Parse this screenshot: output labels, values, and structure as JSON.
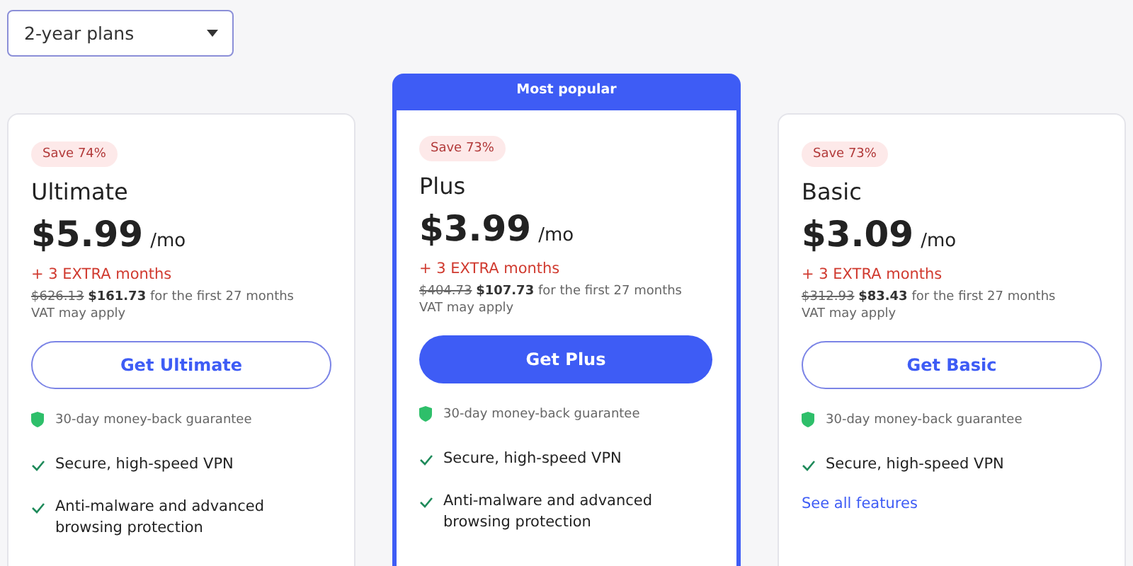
{
  "period_select": {
    "value": "2-year plans"
  },
  "plans": [
    {
      "featured": false,
      "badge": "Save 74%",
      "name": "Ultimate",
      "price": "$5.99",
      "per": "/mo",
      "extra": "+ 3 EXTRA months",
      "old_price": "$626.13",
      "new_price": "$161.73",
      "term": "for the first 27 months",
      "vat": "VAT may apply",
      "button": "Get Ultimate",
      "guarantee": "30-day money-back guarantee",
      "features": [
        "Secure, high-speed VPN",
        "Anti-malware and advanced browsing protection"
      ]
    },
    {
      "featured": true,
      "ribbon": "Most popular",
      "badge": "Save 73%",
      "name": "Plus",
      "price": "$3.99",
      "per": "/mo",
      "extra": "+ 3 EXTRA months",
      "old_price": "$404.73",
      "new_price": "$107.73",
      "term": "for the first 27 months",
      "vat": "VAT may apply",
      "button": "Get Plus",
      "guarantee": "30-day money-back guarantee",
      "features": [
        "Secure, high-speed VPN",
        "Anti-malware and advanced browsing protection"
      ]
    },
    {
      "featured": false,
      "badge": "Save 73%",
      "name": "Basic",
      "price": "$3.09",
      "per": "/mo",
      "extra": "+ 3 EXTRA months",
      "old_price": "$312.93",
      "new_price": "$83.43",
      "term": "for the first 27 months",
      "vat": "VAT may apply",
      "button": "Get Basic",
      "guarantee": "30-day money-back guarantee",
      "features": [
        "Secure, high-speed VPN"
      ],
      "link": "See all features"
    }
  ]
}
